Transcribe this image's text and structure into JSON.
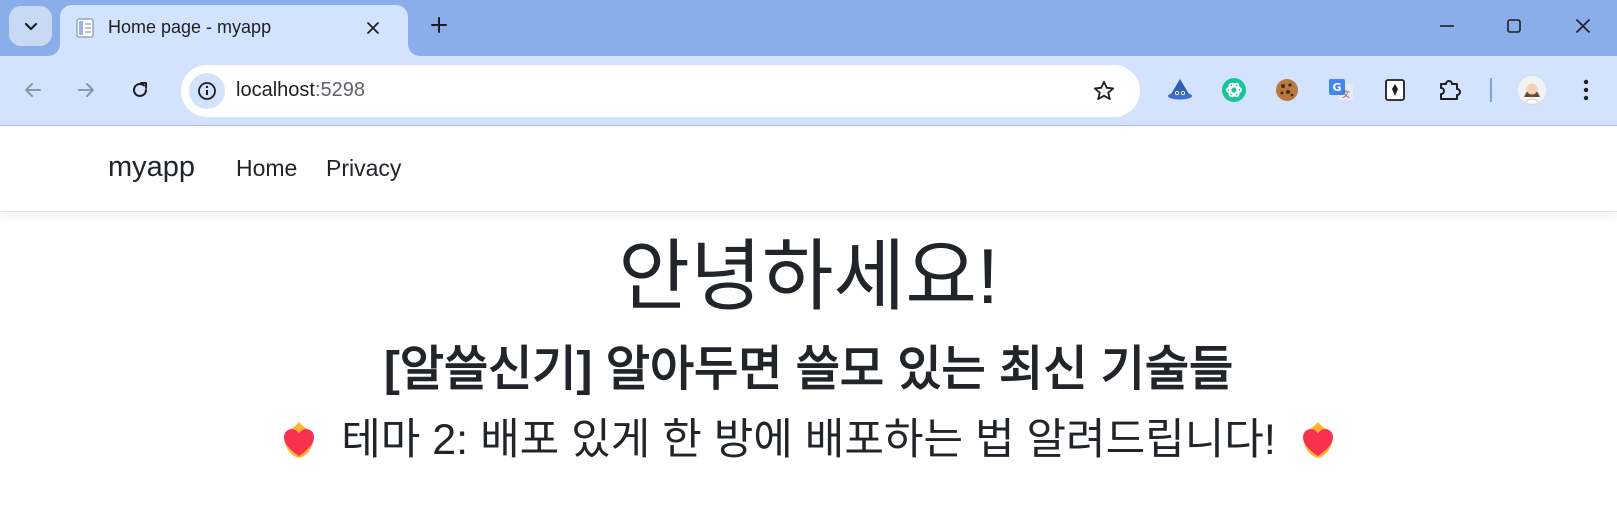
{
  "browser": {
    "tab": {
      "title": "Home page - myapp"
    },
    "address": {
      "host": "localhost",
      "port": ":5298"
    },
    "icons": {
      "tab_search": "chevron-down-icon",
      "favicon": "page-icon",
      "close": "close-icon",
      "new_tab": "plus-icon",
      "back": "back-arrow-icon",
      "forward": "forward-arrow-icon",
      "reload": "reload-icon",
      "site_info": "info-icon",
      "bookmark": "star-icon",
      "extensions": [
        "wizard-hat-icon",
        "chatgpt-icon",
        "cookie-icon",
        "translate-icon",
        "vault-icon",
        "puzzle-icon"
      ],
      "profile": "avatar",
      "menu": "kebab-menu-icon"
    },
    "colors": {
      "tabstrip": "#8aaeea",
      "toolbar": "#d3e3fd"
    }
  },
  "navbar": {
    "brand": "myapp",
    "links": [
      "Home",
      "Privacy"
    ]
  },
  "main": {
    "heading": "안녕하세요!",
    "subheading": "[알쓸신기] 알아두면 쓸모 있는 최신 기술들",
    "theme_line": "테마 2: 배포 있게 한 방에 배포하는 법 알려드립니다!",
    "decoration_icon": "heart-on-fire-icon"
  }
}
